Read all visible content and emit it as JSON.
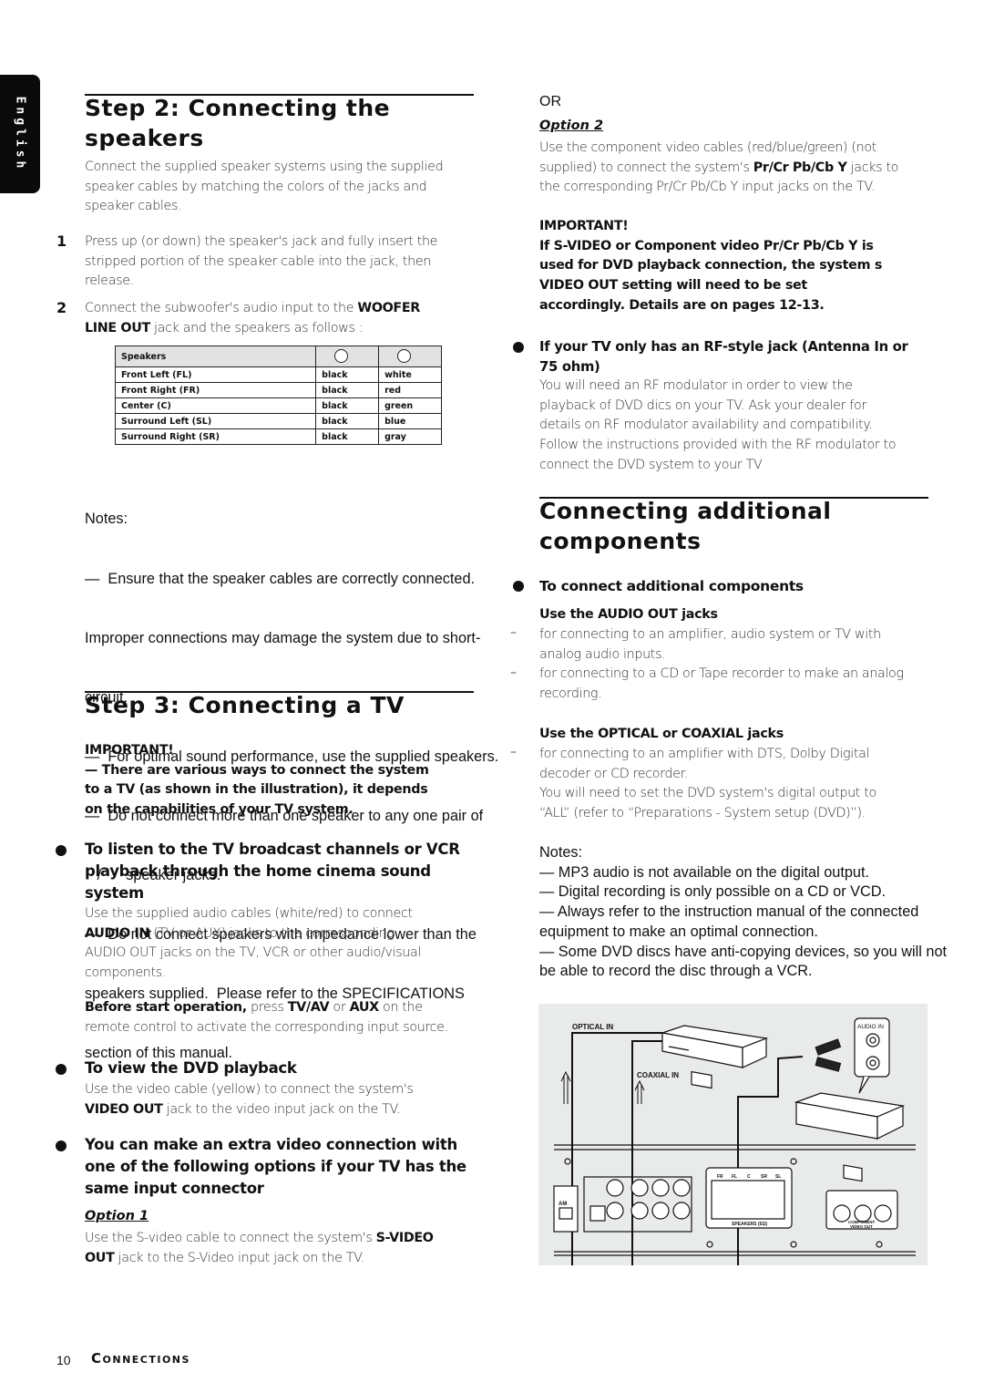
{
  "language_tab": "English",
  "step2": {
    "title_line1": "Step 2: Connecting the",
    "title_line2": "speakers",
    "intro": [
      "Connect the supplied speaker systems using the supplied",
      "speaker cables by matching the colors of the jacks and",
      "speaker cables."
    ],
    "items": [
      {
        "number": "1",
        "lines": [
          "Press up (or down) the speaker's jack and fully insert the",
          "stripped portion of the speaker cable into the jack, then",
          "release."
        ]
      },
      {
        "number": "2",
        "line1_pre": "Connect the subwoofer's audio input to the ",
        "line1_bold": "WOOFER",
        "line2_bold": "LINE OUT",
        "line2_post": " jack and the speakers as follows :"
      }
    ],
    "table": {
      "header": "Speakers",
      "rows": [
        {
          "speaker": "Front Left (FL)",
          "minus": "black",
          "plus": "white"
        },
        {
          "speaker": "Front Right (FR)",
          "minus": "black",
          "plus": "red"
        },
        {
          "speaker": "Center (C)",
          "minus": "black",
          "plus": "green"
        },
        {
          "speaker": "Surround Left (SL)",
          "minus": "black",
          "plus": "blue"
        },
        {
          "speaker": "Surround Right (SR)",
          "minus": "black",
          "plus": "gray"
        }
      ]
    },
    "notes_title": "Notes:",
    "notes": [
      "—  Ensure that the speaker cables are correctly connected.",
      "Improper connections may damage the system due to short-",
      "circuit.",
      "—  For optimal sound performance, use the supplied speakers.",
      "—  Do not connect more than one speaker to any one pair of",
      "   /      speaker jacks.",
      "—  Do not connect speakers with impedance lower than the",
      "speakers supplied.  Please refer to the SPECIFICATIONS",
      "section of this manual."
    ]
  },
  "step3": {
    "title": "Step 3: Connecting a TV",
    "important_label": "IMPORTANT!",
    "important_lines": [
      "— There are various ways to connect the system",
      "to a TV (as shown in the illustration), it depends",
      "on the capabilities of your TV system."
    ],
    "bullet1": {
      "heading": [
        "To listen to the TV broadcast channels or VCR",
        "playback through the home cinema sound",
        "system"
      ],
      "line1": "Use the supplied audio cables (white/red) to connect",
      "line2_bold": "AUDIO IN",
      "line2_post": " (TV or AUX) jacks to the corresponding",
      "line3": "AUDIO OUT jacks on the TV, VCR or other audio/visual",
      "line4": "components.",
      "before_bold": "Before start operation,",
      "before_mid1": " press ",
      "before_tvav": "TV/AV",
      "before_mid2": " or ",
      "before_aux": "AUX",
      "before_post": " on the",
      "before_line2": "remote control to activate the corresponding input source."
    },
    "bullet2": {
      "heading": "To view the DVD playback",
      "line1": "Use the video cable (yellow) to connect the system's",
      "line2_bold": "VIDEO OUT",
      "line2_post": " jack to the video input jack on the TV."
    },
    "bullet3": {
      "heading": [
        "You can make an extra video connection with",
        "one of the following options if your TV has the",
        "same input connector"
      ],
      "option1_label": "Option 1",
      "option1_line1_pre": "Use the S-video cable to connect the system's ",
      "option1_line1_bold": "S-VIDEO",
      "option1_line2_bold": "OUT",
      "option1_line2_post": " jack to the S-Video input jack on the TV."
    }
  },
  "right_col": {
    "or_label": "OR",
    "option2_label": "Option 2",
    "option2_line1": "Use the component video cables (red/blue/green) (not",
    "option2_line2_pre": "supplied) to connect the system's ",
    "option2_line2_bold": "Pr/Cr Pb/Cb Y",
    "option2_line2_post": " jacks to",
    "option2_line3": "the corresponding Pr/Cr Pb/Cb Y input jacks on the TV.",
    "important_label": "IMPORTANT!",
    "important_lines": [
      "If S-VIDEO or Component video Pr/Cr Pb/Cb Y is",
      "used for DVD playback connection, the system s",
      "VIDEO OUT setting will need to be set",
      "accordingly.  Details are on pages 12-13."
    ],
    "rf_heading": [
      "If your TV only has an RF-style jack (Antenna In or",
      "75 ohm)"
    ],
    "rf_lines": [
      "You will need an RF modulator in order to view the",
      "playback of DVD dics on your TV.  Ask your dealer for",
      "details on RF modulator availability and compatibility.",
      "Follow the instructions provided with the RF modulator to",
      "connect the DVD system to your TV"
    ]
  },
  "additional": {
    "title_line1": "Connecting additional",
    "title_line2": "components",
    "bullet_heading": "To connect additional components",
    "audio_out_heading": "Use the AUDIO OUT jacks",
    "audio_out_lines": [
      "for connecting to an amplifier, audio system or TV with",
      "analog audio inputs.",
      "for connecting to a CD or Tape recorder to make an analog",
      "recording."
    ],
    "dash": "–",
    "optical_heading": "Use the OPTICAL or COAXIAL jacks",
    "optical_lines": [
      "for connecting to an amplifier with DTS, Dolby Digital",
      "decoder or CD recorder.",
      "You will need to set the DVD system's digital output to",
      "“ALL” (refer to “Preparations - System setup (DVD)”)."
    ],
    "notes_title": "Notes:",
    "notes": [
      "—  MP3 audio is not available on the digital output.",
      "—  Digital recording is only possible on a CD or VCD.",
      "—  Always refer to the instruction manual of the connected",
      "equipment to make an optimal connection.",
      "—  Some DVD discs have anti-copying devices, so you will not",
      "be able to record the disc through a VCR."
    ]
  },
  "diagram": {
    "optical_in": "OPTICAL IN",
    "coaxial_in": "COAXIAL IN",
    "audio_in": "AUDIO IN",
    "am": "AM",
    "speaker_labels": [
      "FR",
      "FL",
      "C",
      "SR",
      "SL"
    ],
    "speakers_caption": "SPEAKERS (5Ω)",
    "component_caption_1": "COMPONENT",
    "component_caption_2": "VIDEO OUT"
  },
  "footer": {
    "page_number": "10",
    "section": "Connections"
  }
}
